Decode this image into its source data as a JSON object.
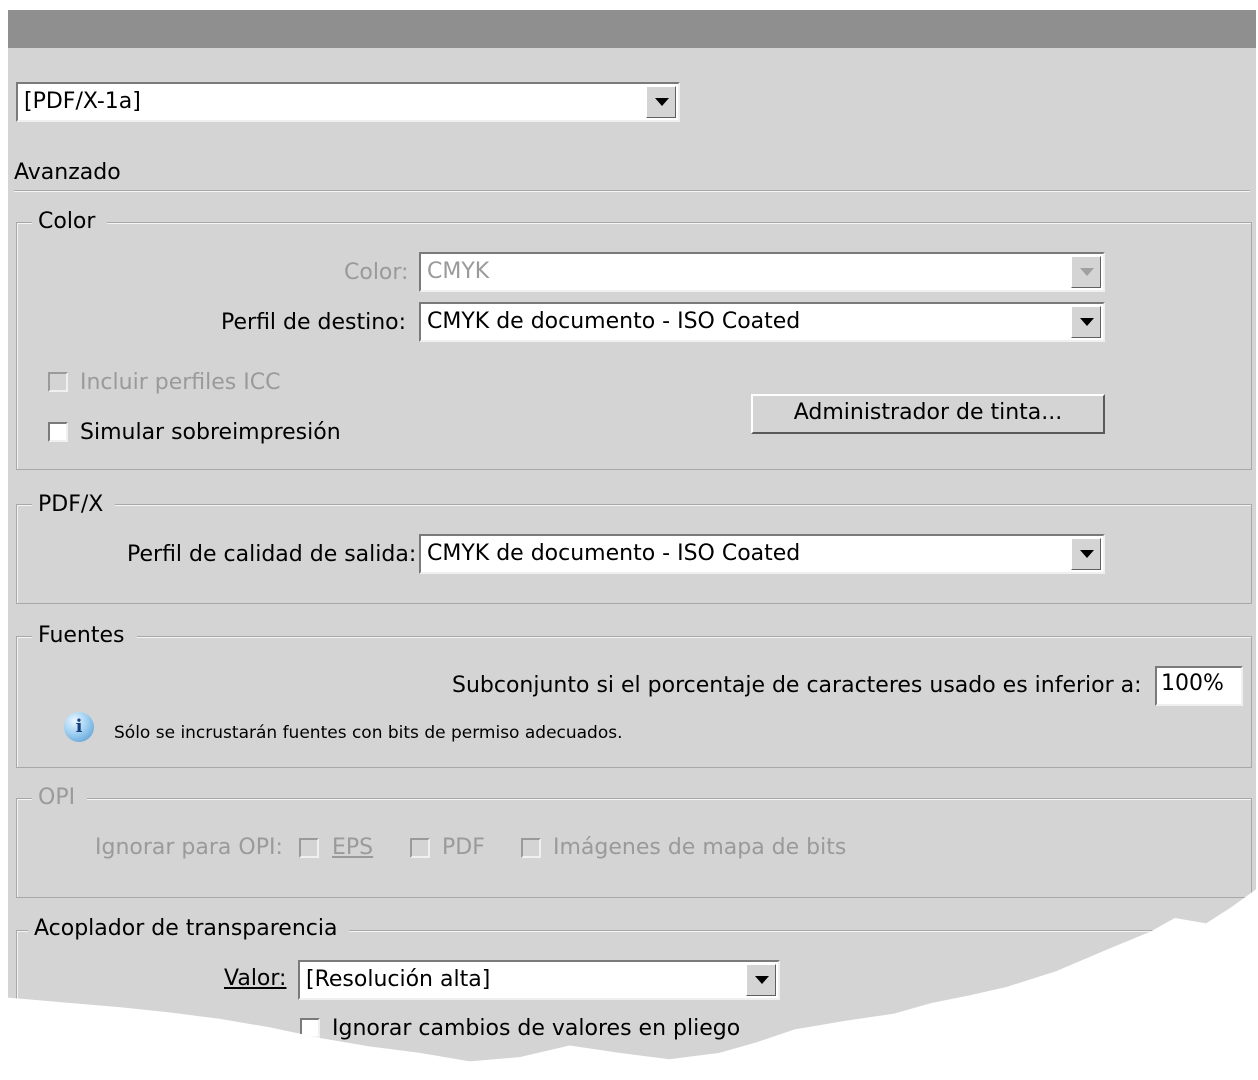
{
  "preset": {
    "value": "[PDF/X-1a]"
  },
  "section_title": "Avanzado",
  "color": {
    "group_title": "Color",
    "conversion_label": "Color:",
    "conversion_value": "CMYK",
    "profile_label": "Perfil de destino:",
    "profile_value": "CMYK de documento - ISO Coated",
    "include_icc_label": "Incluir perfiles ICC",
    "simulate_overprint_label": "Simular sobreimpresión",
    "ink_manager_label": "Administrador de tinta..."
  },
  "pdfx": {
    "group_title": "PDF/X",
    "output_intent_label": "Perfil de calidad de salida:",
    "output_intent_value": "CMYK de documento - ISO Coated"
  },
  "fonts": {
    "group_title": "Fuentes",
    "subset_label": "Subconjunto si el porcentaje de caracteres usado es inferior a:",
    "subset_value": "100%",
    "info_text": "Sólo se incrustarán fuentes con bits de permiso adecuados."
  },
  "opi": {
    "group_title": "OPI",
    "omit_label": "Ignorar para OPI:",
    "eps_label": "EPS",
    "pdf_label": "PDF",
    "bitmap_label": "Imágenes de mapa de bits"
  },
  "flattener": {
    "group_title": "Acoplador de transparencia",
    "preset_label": "Valor:",
    "preset_value": "[Resolución alta]",
    "ignore_overrides_label": "Ignorar cambios de valores en pliego"
  }
}
